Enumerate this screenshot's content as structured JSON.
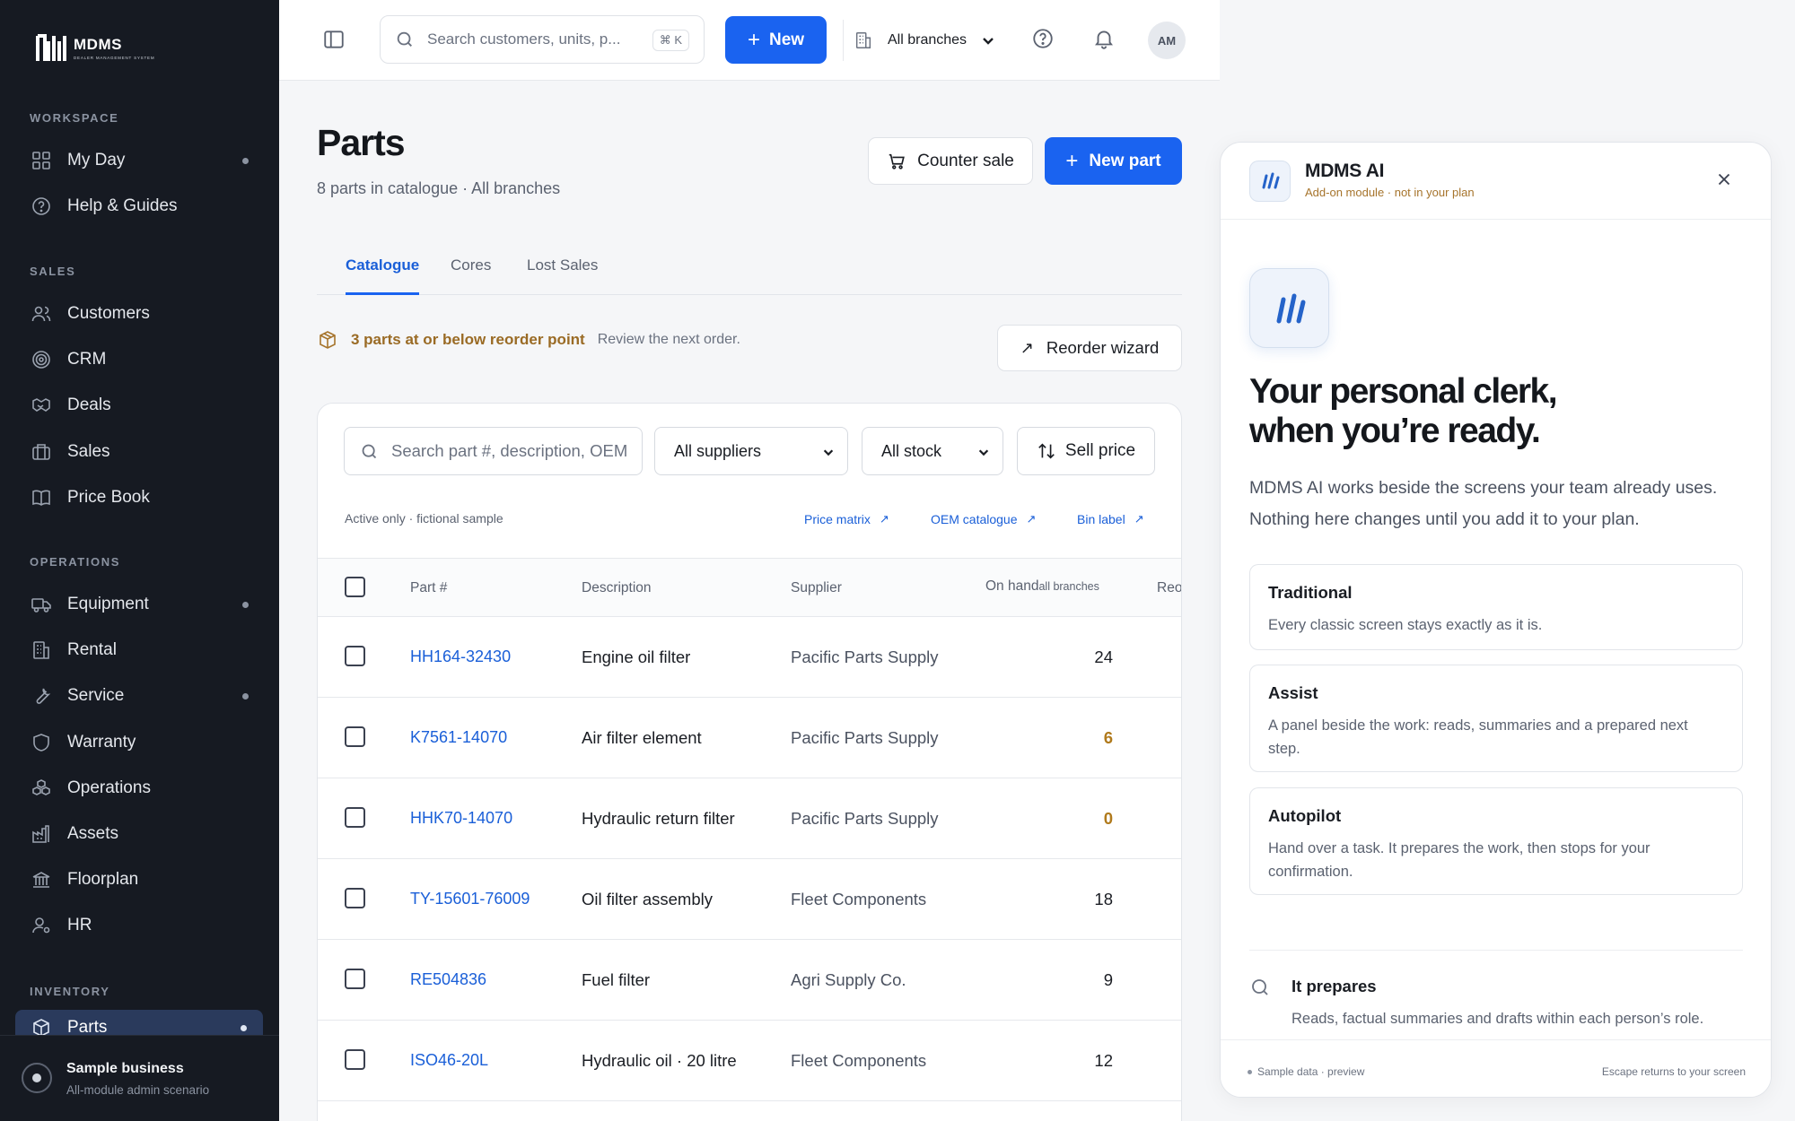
{
  "app": {
    "logo_title": "MDMS",
    "logo_sub": "DEALER MANAGEMENT SYSTEM"
  },
  "sidebar": {
    "sections": [
      "WORKSPACE",
      "SALES",
      "OPERATIONS",
      "INVENTORY"
    ],
    "workspace": [
      {
        "label": "My Day",
        "icon": "grid-icon",
        "dot": true
      },
      {
        "label": "Help & Guides",
        "icon": "help-circle-icon",
        "dot": false
      }
    ],
    "sales": [
      {
        "label": "Customers",
        "icon": "users-icon"
      },
      {
        "label": "CRM",
        "icon": "target-icon"
      },
      {
        "label": "Deals",
        "icon": "handshake-icon"
      },
      {
        "label": "Sales",
        "icon": "briefcase-icon"
      },
      {
        "label": "Price Book",
        "icon": "book-icon"
      }
    ],
    "operations": [
      {
        "label": "Equipment",
        "icon": "truck-icon",
        "dot": true
      },
      {
        "label": "Rental",
        "icon": "building-icon",
        "dot": false
      },
      {
        "label": "Service",
        "icon": "wrench-icon",
        "dot": true
      },
      {
        "label": "Warranty",
        "icon": "shield-icon",
        "dot": false
      },
      {
        "label": "Operations",
        "icon": "cubes-icon",
        "dot": false
      },
      {
        "label": "Assets",
        "icon": "factory-icon",
        "dot": false
      },
      {
        "label": "Floorplan",
        "icon": "bank-icon",
        "dot": false
      },
      {
        "label": "HR",
        "icon": "user-gear-icon",
        "dot": false
      }
    ],
    "inventory": [
      {
        "label": "Parts",
        "icon": "box-icon",
        "dot": true,
        "active": true
      }
    ],
    "business": {
      "name": "Sample business",
      "sub": "All-module admin scenario"
    }
  },
  "topbar": {
    "search_placeholder": "Search customers, units, p...",
    "search_shortcut": "⌘ K",
    "new_label": "New",
    "branch_label": "All branches",
    "avatar_initials": "AM"
  },
  "page": {
    "title": "Parts",
    "subtitle": "8 parts in catalogue · All branches",
    "counter_sale_label": "Counter sale",
    "new_part_label": "New part",
    "tabs": [
      "Catalogue",
      "Cores",
      "Lost Sales"
    ],
    "active_tab": "Catalogue",
    "alert_strong": "3 parts at or below reorder point",
    "alert_weak": "Review the next order.",
    "reorder_label": "Reorder wizard"
  },
  "table_card": {
    "search_placeholder": "Search part #, description, OEM",
    "supplier_filter": "All suppliers",
    "stock_filter": "All stock",
    "sell_price_label": "Sell price",
    "note": "Active only · fictional sample",
    "links": [
      "Price matrix",
      "OEM catalogue",
      "Bin label"
    ],
    "columns": {
      "part": "Part #",
      "description": "Description",
      "supplier": "Supplier",
      "on_hand": "On hand",
      "on_hand_sub": "all branches",
      "reorder": "Reo"
    },
    "rows": [
      {
        "part": "HH164-32430",
        "description": "Engine oil filter",
        "supplier": "Pacific Parts Supply",
        "on_hand": "24",
        "status": "normal"
      },
      {
        "part": "K7561-14070",
        "description": "Air filter element",
        "supplier": "Pacific Parts Supply",
        "on_hand": "6",
        "status": "low"
      },
      {
        "part": "HHK70-14070",
        "description": "Hydraulic return filter",
        "supplier": "Pacific Parts Supply",
        "on_hand": "0",
        "status": "low"
      },
      {
        "part": "TY-15601-76009",
        "description": "Oil filter assembly",
        "supplier": "Fleet Components",
        "on_hand": "18",
        "status": "normal"
      },
      {
        "part": "RE504836",
        "description": "Fuel filter",
        "supplier": "Agri Supply Co.",
        "on_hand": "9",
        "status": "normal"
      },
      {
        "part": "ISO46-20L",
        "description": "Hydraulic oil · 20 litre",
        "supplier": "Fleet Components",
        "on_hand": "12",
        "status": "normal"
      }
    ]
  },
  "ai_panel": {
    "title": "MDMS AI",
    "subtitle": "Add-on module · not in your plan",
    "hero_line1": "Your personal clerk,",
    "hero_line2": "when you’re ready.",
    "description": "MDMS AI works beside the screens your team already uses. Nothing here changes until you add it to your plan.",
    "options": [
      {
        "title": "Traditional",
        "desc": "Every classic screen stays exactly as it is."
      },
      {
        "title": "Assist",
        "desc": "A panel beside the work: reads, summaries and a prepared next step."
      },
      {
        "title": "Autopilot",
        "desc": "Hand over a task. It prepares the work, then stops for your confirmation."
      }
    ],
    "prepares_title": "It prepares",
    "prepares_desc": "Reads, factual summaries and drafts within each person’s role.",
    "footer_left": "Sample data · preview",
    "footer_right": "Escape returns to your screen"
  },
  "colors": {
    "accent": "#1a63f0",
    "sidebar_bg": "#161a22",
    "warning": "#a6742c"
  }
}
